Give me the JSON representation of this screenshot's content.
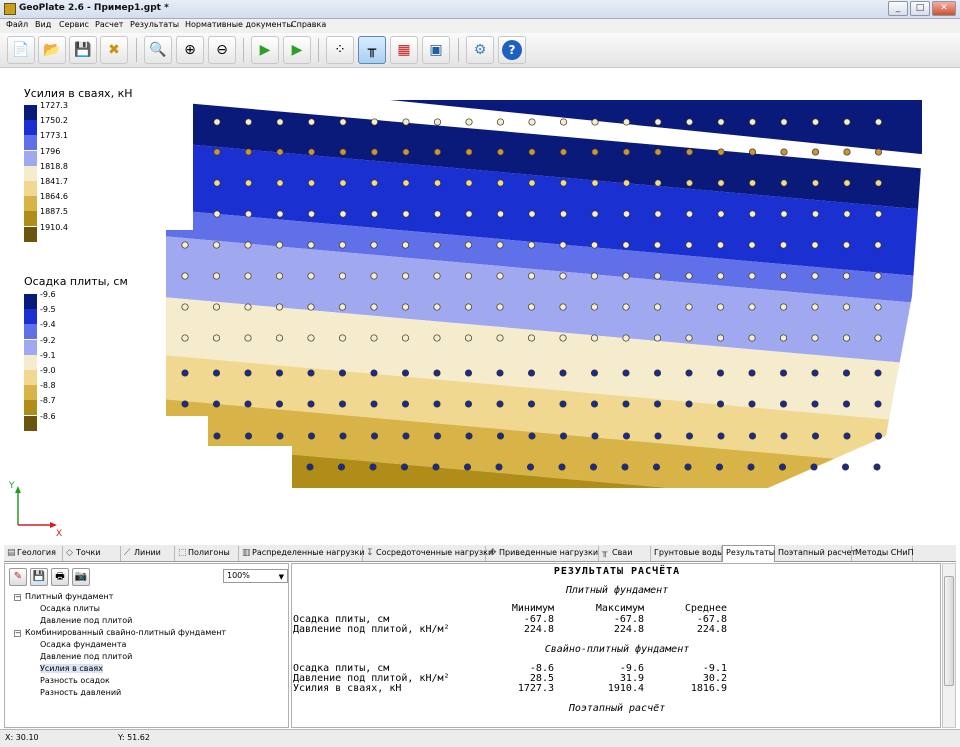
{
  "window": {
    "title": "GeoPlate 2.6 - Пример1.gpt *",
    "controls": [
      "_",
      "□",
      "✕"
    ]
  },
  "menu": [
    "Файл",
    "Вид",
    "Сервис",
    "Расчет",
    "Результаты",
    "Нормативные документы",
    "Справка"
  ],
  "toolbar": [
    {
      "name": "new-document-button",
      "icon": "📄"
    },
    {
      "name": "open-button",
      "icon": "📂"
    },
    {
      "name": "save-button",
      "icon": "💾"
    },
    {
      "name": "close-file-button",
      "icon": "✖"
    },
    {
      "name": "zoom-button",
      "icon": "🔍"
    },
    {
      "name": "zoom-in-button",
      "icon": "⊕"
    },
    {
      "name": "zoom-out-button",
      "icon": "⊖"
    },
    {
      "name": "run-calc-1-button",
      "icon": "▶"
    },
    {
      "name": "run-calc-2-button",
      "icon": "▶"
    },
    {
      "name": "grid-points-button",
      "icon": "⁘"
    },
    {
      "name": "piles-view-button",
      "icon": "╥"
    },
    {
      "name": "loads-view-button",
      "icon": "▦"
    },
    {
      "name": "image-button",
      "icon": "▣"
    },
    {
      "name": "settings-button",
      "icon": "⚙"
    },
    {
      "name": "help-button",
      "icon": "?"
    }
  ],
  "legend_force": {
    "title": "Усилия в сваях, кН",
    "labels": [
      "1727.3",
      "1750.2",
      "1773.1",
      "1796",
      "1818.8",
      "1841.7",
      "1864.6",
      "1887.5",
      "1910.4"
    ],
    "colors": [
      "#0a1a7a",
      "#1a30d0",
      "#6070e8",
      "#a0a8f0",
      "#f4eccc",
      "#f0d890",
      "#d8b448",
      "#b08c18",
      "#6a5410"
    ]
  },
  "legend_settle": {
    "title": "Осадка плиты, см",
    "labels": [
      "-9.6",
      "-9.5",
      "-9.4",
      "-9.2",
      "-9.1",
      "-9.0",
      "-8.8",
      "-8.7",
      "-8.6"
    ],
    "colors": [
      "#0a1a7a",
      "#1a30d0",
      "#6070e8",
      "#a0a8f0",
      "#f4eccc",
      "#f0d890",
      "#d8b448",
      "#b08c18",
      "#6a5410"
    ]
  },
  "axes": {
    "x": "X",
    "y": "Y"
  },
  "tabs": [
    {
      "label": "Геология",
      "icon": "▤"
    },
    {
      "label": "Точки",
      "icon": "◇"
    },
    {
      "label": "Линии",
      "icon": "⟋"
    },
    {
      "label": "Полигоны",
      "icon": "⬚"
    },
    {
      "label": "Распределенные нагрузки",
      "icon": "▥"
    },
    {
      "label": "Сосредоточенные нагрузки",
      "icon": "↧"
    },
    {
      "label": "Приведенные нагрузки",
      "icon": "✥"
    },
    {
      "label": "Сваи",
      "icon": "╥"
    },
    {
      "label": "Грунтовые воды",
      "icon": ""
    },
    {
      "label": "Результаты",
      "icon": ""
    },
    {
      "label": "Поэтапный расчет",
      "icon": ""
    },
    {
      "label": "Методы СНиП",
      "icon": ""
    }
  ],
  "active_tab": "Результаты",
  "bottom_left": {
    "buttons": [
      "✎",
      "💾",
      "🖶",
      "📷"
    ],
    "zoom": "100%",
    "tree": [
      {
        "label": "Плитный фундамент",
        "level": 0,
        "toggle": "−"
      },
      {
        "label": "Осадка плиты",
        "level": 1
      },
      {
        "label": "Давление под плитой",
        "level": 1
      },
      {
        "label": "Комбинированный свайно-плитный фундамент",
        "level": 0,
        "toggle": "−"
      },
      {
        "label": "Осадка фундамента",
        "level": 1
      },
      {
        "label": "Давление под плитой",
        "level": 1
      },
      {
        "label": "Усилия в сваях",
        "level": 1,
        "selected": true
      },
      {
        "label": "Разность осадок",
        "level": 1
      },
      {
        "label": "Разность давлений",
        "level": 1
      }
    ]
  },
  "results": {
    "title": "РЕЗУЛЬТАТЫ РАСЧЁТА",
    "section1": "Плитный фундамент",
    "headers": [
      "Минимум",
      "Максимум",
      "Среднее"
    ],
    "rows1": [
      {
        "label": "Осадка плиты, см",
        "min": "-67.8",
        "max": "-67.8",
        "avg": "-67.8"
      },
      {
        "label": "Давление под плитой, кН/м²",
        "min": "224.8",
        "max": "224.8",
        "avg": "224.8"
      }
    ],
    "section2": "Свайно-плитный фундамент",
    "rows2": [
      {
        "label": "Осадка плиты, см",
        "min": "-8.6",
        "max": "-9.6",
        "avg": "-9.1"
      },
      {
        "label": "Давление под плитой, кН/м²",
        "min": "28.5",
        "max": "31.9",
        "avg": "30.2"
      },
      {
        "label": "Усилия в сваях, кН",
        "min": "1727.3",
        "max": "1910.4",
        "avg": "1816.9"
      }
    ],
    "section3": "Поэтапный расчёт"
  },
  "status": {
    "x": "X: 30.10",
    "y": "Y: 51.62"
  }
}
